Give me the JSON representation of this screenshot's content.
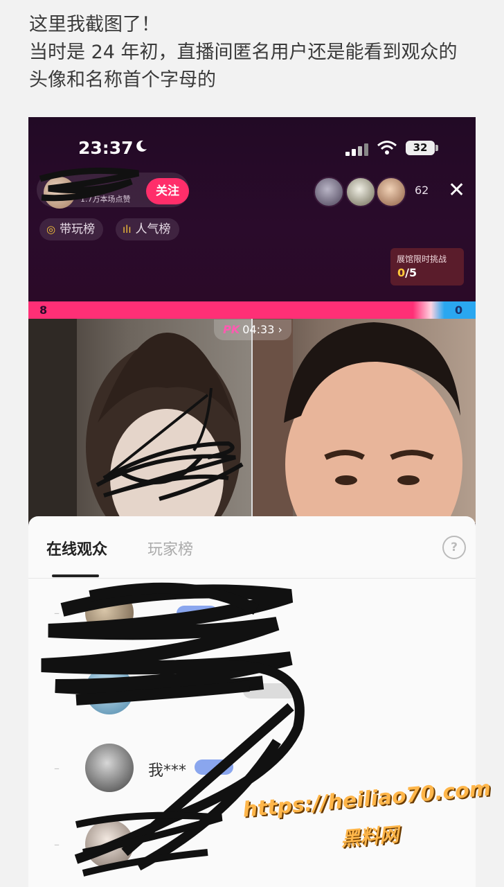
{
  "caption": {
    "line1": "这里我截图了！",
    "line2": "当时是 24 年初，直播间匿名用户还是能看到观众的",
    "line3": "头像和名称首个字母的"
  },
  "status_bar": {
    "time": "23:37",
    "battery": "32"
  },
  "host": {
    "likes": "1.7万本场点赞",
    "follow_label": "关注"
  },
  "viewers": {
    "count": "62"
  },
  "chips": {
    "play_rank": "带玩榜",
    "popularity_rank": "人气榜"
  },
  "challenge": {
    "title": "展馆限时挑战",
    "progress_current": "0",
    "progress_total": "/5"
  },
  "pk": {
    "left_score": "8",
    "right_score": "0",
    "timer_label": "PK",
    "timer": "04:33 ›"
  },
  "audience_panel": {
    "tab_active": "在线观众",
    "tab_inactive": "玩家榜",
    "help_icon_label": "?",
    "rows": [
      {
        "rank": "–",
        "name": ""
      },
      {
        "rank": "–",
        "name": ""
      },
      {
        "rank": "–",
        "name": "我***"
      },
      {
        "rank": "–",
        "name": ""
      }
    ]
  },
  "watermark": {
    "url": "https://heiliao70.com",
    "site": "黑料网"
  }
}
